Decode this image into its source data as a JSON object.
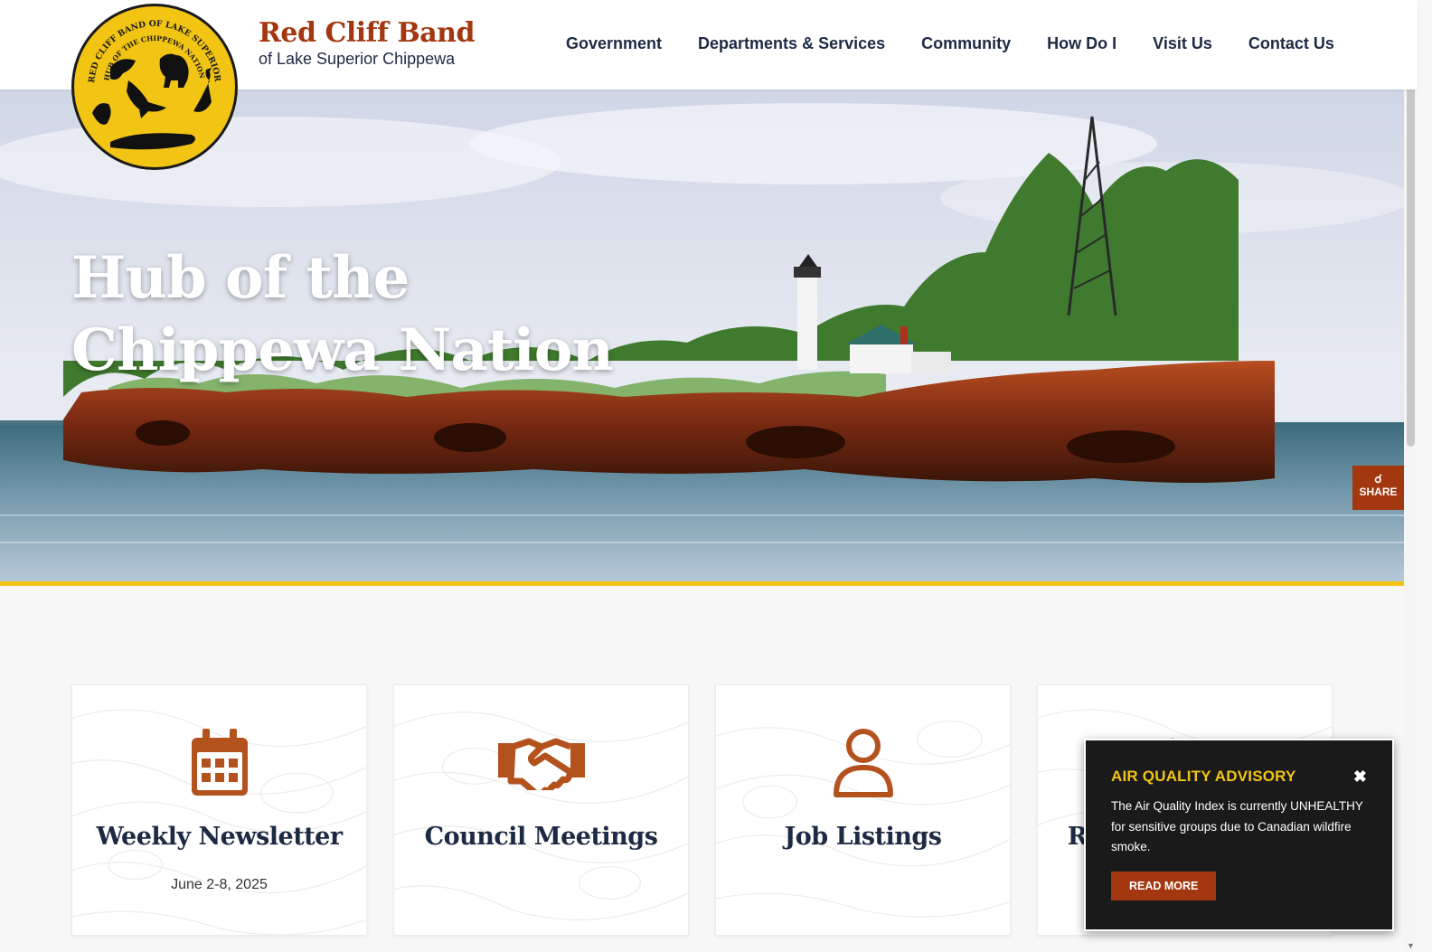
{
  "brand": {
    "name": "Red Cliff Band",
    "subtitle": "of Lake Superior Chippewa",
    "seal_text_outer": "RED CLIFF BAND OF LAKE SUPERIOR CHIPPEWA",
    "seal_text_inner": "HUB OF THE CHIPPEWA NATION"
  },
  "nav": {
    "items": [
      {
        "label": "Government"
      },
      {
        "label": "Departments & Services"
      },
      {
        "label": "Community"
      },
      {
        "label": "How Do I"
      },
      {
        "label": "Visit Us"
      },
      {
        "label": "Contact Us"
      }
    ]
  },
  "hero": {
    "title_line1": "Hub of the",
    "title_line2": "Chippewa Nation",
    "share_label": "SHARE",
    "share_icon": "share-icon"
  },
  "cards": [
    {
      "title": "Weekly Newsletter",
      "subtitle": "June 2-8, 2025",
      "icon": "calendar-icon"
    },
    {
      "title": "Council Meetings",
      "subtitle": "",
      "icon": "handshake-icon"
    },
    {
      "title": "Job Listings",
      "subtitle": "",
      "icon": "user-icon"
    },
    {
      "title": "Requests for Bids",
      "subtitle": "",
      "icon": "handshake-icon"
    }
  ],
  "advisory": {
    "title": "AIR QUALITY ADVISORY",
    "close": "✖",
    "text": "The Air Quality Index is currently UNHEALTHY for sensitive groups due to Canadian wildfire smoke.",
    "button": "READ MORE"
  },
  "colors": {
    "brand_red": "#a3370f",
    "brand_gold": "#f2c414",
    "navy": "#1d2a44",
    "icon_brown": "#b4521e"
  }
}
